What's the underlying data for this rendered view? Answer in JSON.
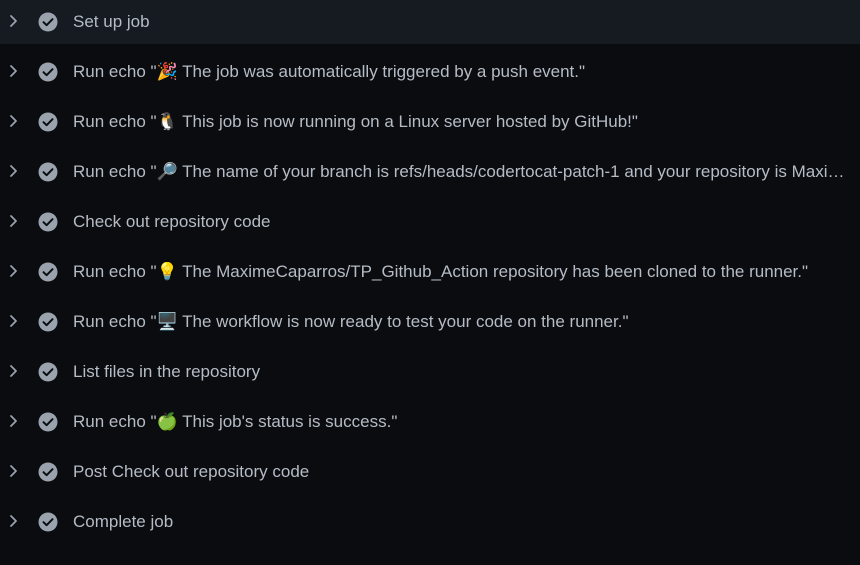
{
  "steps": [
    {
      "label": "Set up job",
      "status_icon": "check-circle-icon",
      "expand_icon": "chevron-right-icon"
    },
    {
      "label": "Run echo \"🎉 The job was automatically triggered by a push event.\"",
      "status_icon": "check-circle-icon",
      "expand_icon": "chevron-right-icon"
    },
    {
      "label": "Run echo \"🐧 This job is now running on a Linux server hosted by GitHub!\"",
      "status_icon": "check-circle-icon",
      "expand_icon": "chevron-right-icon"
    },
    {
      "label": "Run echo \"🔎 The name of your branch is refs/heads/codertocat-patch-1 and your repository is Maxi…",
      "status_icon": "check-circle-icon",
      "expand_icon": "chevron-right-icon"
    },
    {
      "label": "Check out repository code",
      "status_icon": "check-circle-icon",
      "expand_icon": "chevron-right-icon"
    },
    {
      "label": "Run echo \"💡 The MaximeCaparros/TP_Github_Action repository has been cloned to the runner.\"",
      "status_icon": "check-circle-icon",
      "expand_icon": "chevron-right-icon"
    },
    {
      "label": "Run echo \"🖥️ The workflow is now ready to test your code on the runner.\"",
      "status_icon": "check-circle-icon",
      "expand_icon": "chevron-right-icon"
    },
    {
      "label": "List files in the repository",
      "status_icon": "check-circle-icon",
      "expand_icon": "chevron-right-icon"
    },
    {
      "label": "Run echo \"🍏 This job's status is success.\"",
      "status_icon": "check-circle-icon",
      "expand_icon": "chevron-right-icon"
    },
    {
      "label": "Post Check out repository code",
      "status_icon": "check-circle-icon",
      "expand_icon": "chevron-right-icon"
    },
    {
      "label": "Complete job",
      "status_icon": "check-circle-icon",
      "expand_icon": "chevron-right-icon"
    }
  ],
  "colors": {
    "background": "#0a0c10",
    "highlight_row": "#161b22",
    "text": "#b5bcc5",
    "icon": "#9aa3ad"
  }
}
